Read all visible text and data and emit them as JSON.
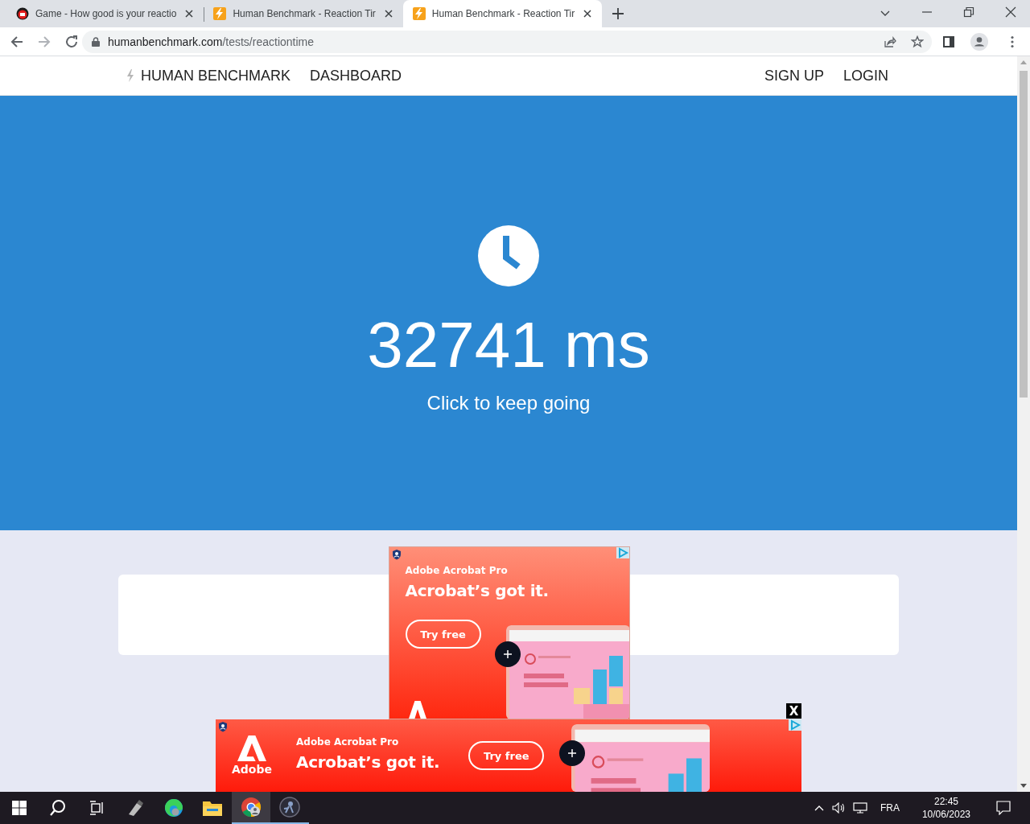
{
  "browser": {
    "tabs": [
      {
        "title": "Game - How good is your reactio",
        "kind": "badge",
        "selected": false
      },
      {
        "title": "Human Benchmark - Reaction Tir",
        "kind": "bolt",
        "selected": false
      },
      {
        "title": "Human Benchmark - Reaction Tir",
        "kind": "bolt",
        "selected": true
      }
    ],
    "url": {
      "host": "humanbenchmark.com",
      "path": "/tests/reactiontime"
    }
  },
  "nav": {
    "brand": "HUMAN BENCHMARK",
    "links": [
      "DASHBOARD"
    ],
    "account": [
      "SIGN UP",
      "LOGIN"
    ]
  },
  "hero": {
    "result": "32741 ms",
    "prompt": "Click to keep going"
  },
  "ads": [
    {
      "kind": "box",
      "product": "Adobe Acrobat Pro",
      "headline": "Acrobat’s got it.",
      "button": "Try free"
    },
    {
      "kind": "banner",
      "brand": "Adobe",
      "product": "Adobe Acrobat Pro",
      "headline": "Acrobat’s got it.",
      "button": "Try free",
      "close": "X"
    }
  ],
  "taskbar": {
    "apps": [
      {
        "kind": "usb",
        "selected": false
      },
      {
        "kind": "edge",
        "selected": false
      },
      {
        "kind": "files",
        "selected": false
      },
      {
        "kind": "chrome",
        "selected": true
      },
      {
        "kind": "game",
        "selected": false
      }
    ],
    "language": "FRA",
    "time": "22:45",
    "date": "10/06/2023"
  }
}
